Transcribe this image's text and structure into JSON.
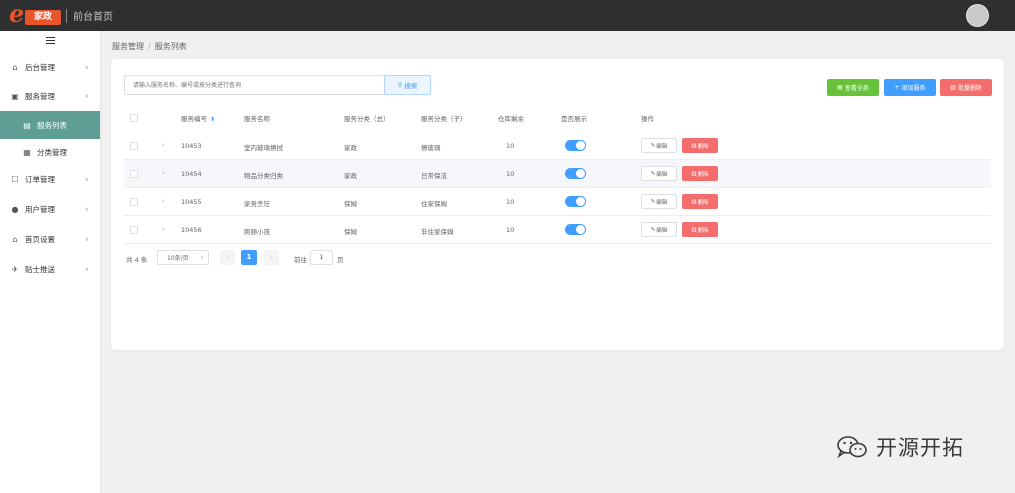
{
  "topbar": {
    "logo_letter": "e",
    "logo_text": "家政",
    "home_link": "前台首页"
  },
  "sidebar": {
    "items": [
      {
        "label": "后台管理",
        "icon": "home-icon",
        "arrow": "∨"
      },
      {
        "label": "服务管理",
        "icon": "services-icon",
        "arrow": "∧"
      },
      {
        "label": "服务列表",
        "icon": "list-icon",
        "active": true
      },
      {
        "label": "分类管理",
        "icon": "grid-icon"
      },
      {
        "label": "订单管理",
        "icon": "order-icon",
        "arrow": "∨"
      },
      {
        "label": "用户管理",
        "icon": "user-icon",
        "arrow": "∨"
      },
      {
        "label": "首页设置",
        "icon": "homepage-icon",
        "arrow": "∨"
      },
      {
        "label": "贴士推送",
        "icon": "push-icon",
        "arrow": "∨"
      }
    ]
  },
  "breadcrumb": {
    "parent": "服务管理",
    "separator": "/",
    "current": "服务列表"
  },
  "search": {
    "placeholder": "请输入服务名称、编号或按分类进行查询",
    "button_label": "搜索"
  },
  "actions": {
    "view_all": "查看全部",
    "add_service": "添加服务",
    "batch_delete": "批量删除"
  },
  "table": {
    "headers": {
      "service_id": "服务编号",
      "service_name": "服务名称",
      "category_main": "服务分类（总）",
      "category_sub": "服务分类（子）",
      "stock": "仓库剩余",
      "display": "是否展示",
      "operation": "操作"
    },
    "edit_label": "编辑",
    "delete_label": "删除",
    "rows": [
      {
        "id": "10453",
        "name": "室内玻璃擦拭",
        "main": "家政",
        "sub": "擦玻璃",
        "stock": "10",
        "display": true
      },
      {
        "id": "10454",
        "name": "物品分类归类",
        "main": "家政",
        "sub": "日常保洁",
        "stock": "10",
        "display": true
      },
      {
        "id": "10455",
        "name": "家务烹饪",
        "main": "保姆",
        "sub": "住家保姆",
        "stock": "10",
        "display": true
      },
      {
        "id": "10456",
        "name": "照顾小孩",
        "main": "保姆",
        "sub": "非住家保姆",
        "stock": "10",
        "display": true
      }
    ]
  },
  "pagination": {
    "total": "共 4 条",
    "page_size": "10条/页",
    "current_page": "1",
    "goto_label": "前往",
    "goto_value": "1",
    "page_unit": "页"
  },
  "watermark": {
    "text": "开源开拓"
  },
  "colors": {
    "accent": "#409eff",
    "success": "#67c23a",
    "danger": "#f56c6c",
    "sidebar_active": "#5f9e95",
    "topbar": "#2d2f31",
    "brand": "#e8542c"
  }
}
